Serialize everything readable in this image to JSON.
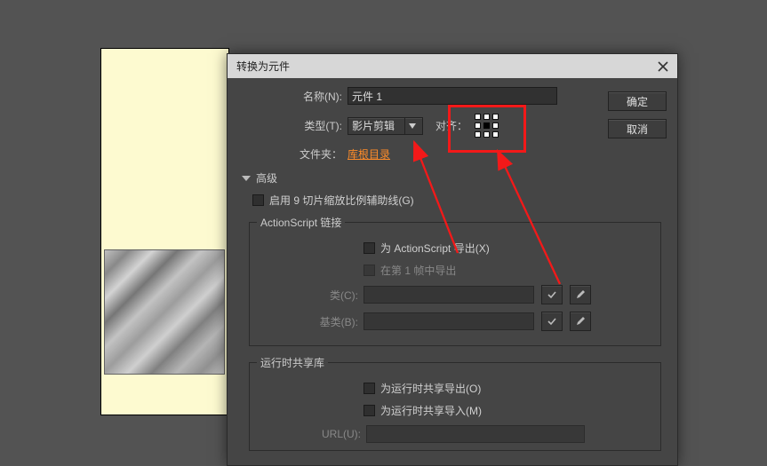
{
  "dialog": {
    "title": "转换为元件",
    "name_label": "名称(N):",
    "name_value": "元件 1",
    "type_label": "类型(T):",
    "type_value": "影片剪辑",
    "align_label": "对齐：",
    "folder_label": "文件夹：",
    "folder_link": "库根目录",
    "advanced": "高级",
    "nine_slice": "启用 9 切片缩放比例辅助线(G)",
    "as_group": "ActionScript 链接",
    "export_as": "为 ActionScript 导出(X)",
    "export_frame1": "在第 1 帧中导出",
    "class_label": "类(C):",
    "base_label": "基类(B):",
    "rsl_group": "运行时共享库",
    "rsl_export": "为运行时共享导出(O)",
    "rsl_import": "为运行时共享导入(M)",
    "url_label": "URL(U):",
    "ok": "确定",
    "cancel": "取消"
  }
}
